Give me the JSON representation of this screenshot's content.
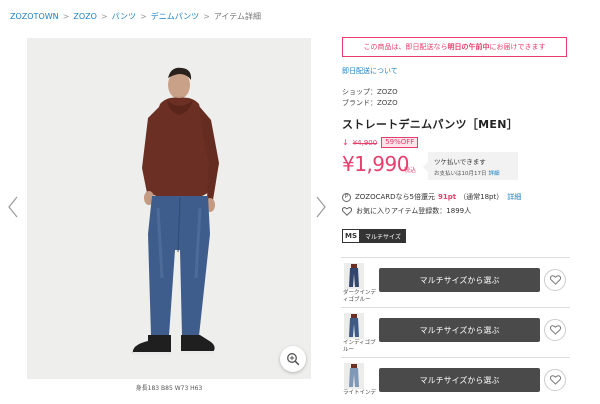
{
  "breadcrumb": {
    "items": [
      "ZOZOTOWN",
      "ZOZO",
      "パンツ",
      "デニムパンツ"
    ],
    "current": "アイテム詳細",
    "separator": ">"
  },
  "image": {
    "caption": "身長183 B85 W73 H63"
  },
  "delivery": {
    "banner_prefix": "この商品は、即日配送なら",
    "banner_bold": "明日の午前中",
    "banner_suffix": "にお届けできます",
    "link": "即日配送について"
  },
  "product": {
    "shop": "ショップ：ZOZO",
    "brand": "ブランド：ZOZO",
    "title": "ストレートデニムパンツ［MEN］",
    "old_price": "¥4,900",
    "discount": "59%OFF",
    "price": "¥1,990",
    "tax_label": "税込"
  },
  "payment": {
    "title": "ツケ払いできます",
    "sub": "お支払いは10月17日",
    "detail": "詳細"
  },
  "points": {
    "icon": "P",
    "prefix": "ZOZOCARDなら5倍還元",
    "value": "91pt",
    "note": "（通常18pt）",
    "detail": "詳細"
  },
  "favorites": {
    "text": "お気に入りアイテム登録数：1899人"
  },
  "size_badge": {
    "code": "MS",
    "label": "マルチサイズ"
  },
  "colors": [
    {
      "name": "ダークインディゴブルー",
      "button": "マルチサイズから選ぶ",
      "swatch": "#33476e"
    },
    {
      "name": "インディゴブルー",
      "button": "マルチサイズから選ぶ",
      "swatch": "#3e5a86"
    },
    {
      "name": "ライトインデ",
      "button": "マルチサイズから選ぶ",
      "swatch": "#7f98b8"
    }
  ],
  "theme": {
    "accent": "#e83e6c",
    "link": "#1a7fc1",
    "button": "#4a4a4a",
    "background": "#eeeeec"
  }
}
